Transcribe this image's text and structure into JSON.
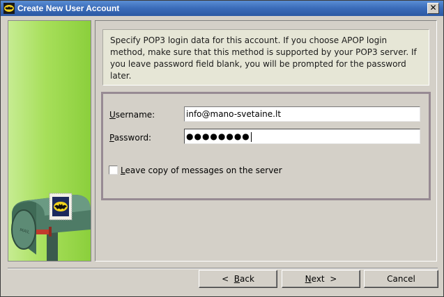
{
  "window": {
    "title": "Create New User Account",
    "close_label": "✕"
  },
  "info": {
    "text": "Specify POP3 login data for this account. If you choose APOP login method, make sure that this method is supported by your POP3 server. If you leave password field blank, you will be prompted for the password later."
  },
  "form": {
    "username_label_u": "U",
    "username_label_rest": "sername:",
    "username_value": "info@mano-svetaine.lt",
    "password_label_u": "P",
    "password_label_rest": "assword:",
    "password_masked": "●●●●●●●●",
    "leave_copy_u": "L",
    "leave_copy_rest": "eave copy of messages on the server",
    "leave_copy_checked": false
  },
  "buttons": {
    "back_prefix": "<  ",
    "back_u": "B",
    "back_rest": "ack",
    "next_u": "N",
    "next_rest": "ext  >",
    "cancel": "Cancel"
  },
  "illustration": {
    "mailbox_text": "MAIL"
  }
}
